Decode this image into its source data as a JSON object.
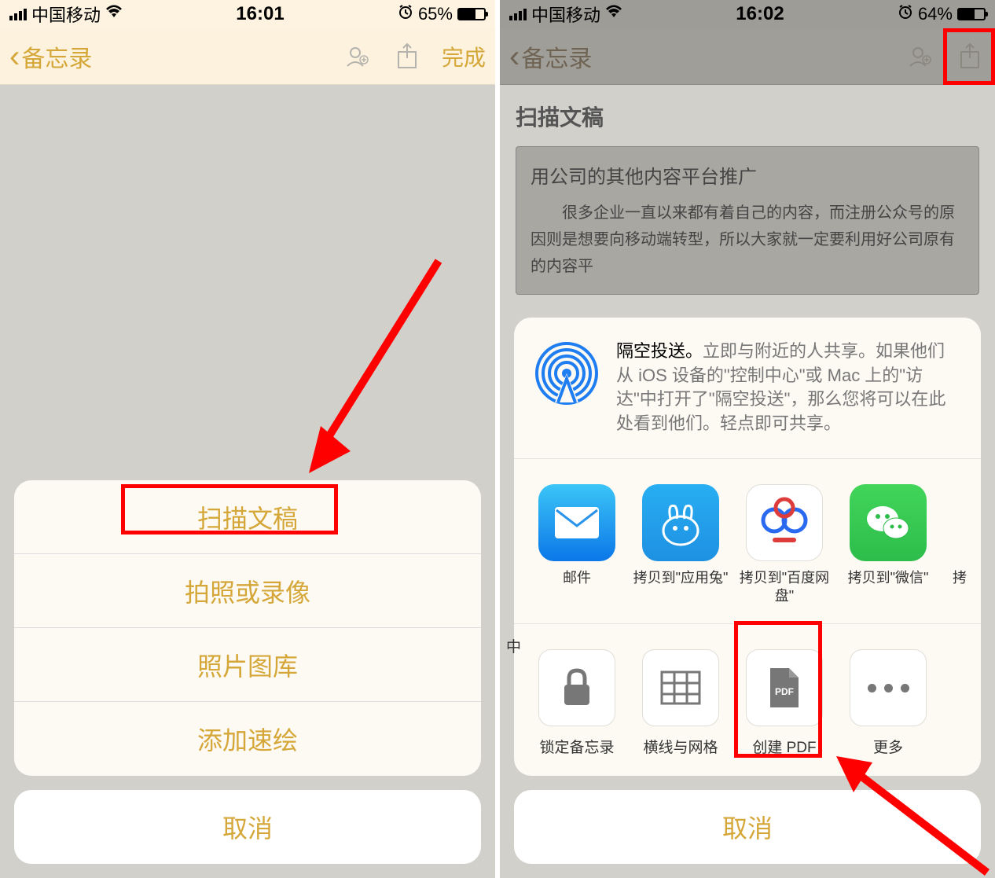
{
  "phone1": {
    "status": {
      "carrier": "中国移动",
      "time": "16:01",
      "battery": "65%"
    },
    "nav": {
      "back": "备忘录",
      "done": "完成"
    },
    "sheet": {
      "items": [
        "扫描文稿",
        "拍照或录像",
        "照片图库",
        "添加速绘"
      ],
      "cancel": "取消"
    }
  },
  "phone2": {
    "status": {
      "carrier": "中国移动",
      "time": "16:02",
      "battery": "64%"
    },
    "nav": {
      "back": "备忘录"
    },
    "note": {
      "title": "扫描文稿",
      "frame_heading": "用公司的其他内容平台推广",
      "frame_body": "很多企业一直以来都有着自己的内容，而注册公众号的原因则是想要向移动端转型，所以大家就一定要利用好公司原有的内容平"
    },
    "share": {
      "airdrop": {
        "title": "隔空投送。",
        "text": "立即与附近的人共享。如果他们从 iOS 设备的\"控制中心\"或 Mac 上的\"访达\"中打开了\"隔空投送\"，那么您将可以在此处看到他们。轻点即可共享。"
      },
      "apps": [
        {
          "name": "mail",
          "label": "邮件"
        },
        {
          "name": "tutu",
          "label": "拷贝到\"应用兔\""
        },
        {
          "name": "baidu",
          "label": "拷贝到\"百度网盘\""
        },
        {
          "name": "wechat",
          "label": "拷贝到\"微信\""
        },
        {
          "name": "copy",
          "label": "拷"
        }
      ],
      "actions": [
        {
          "name": "lock",
          "label": "锁定备忘录"
        },
        {
          "name": "lines",
          "label": "横线与网格"
        },
        {
          "name": "pdf",
          "label": "创建 PDF"
        },
        {
          "name": "more",
          "label": "更多"
        }
      ],
      "cut_text": "中",
      "cancel": "取消"
    }
  }
}
